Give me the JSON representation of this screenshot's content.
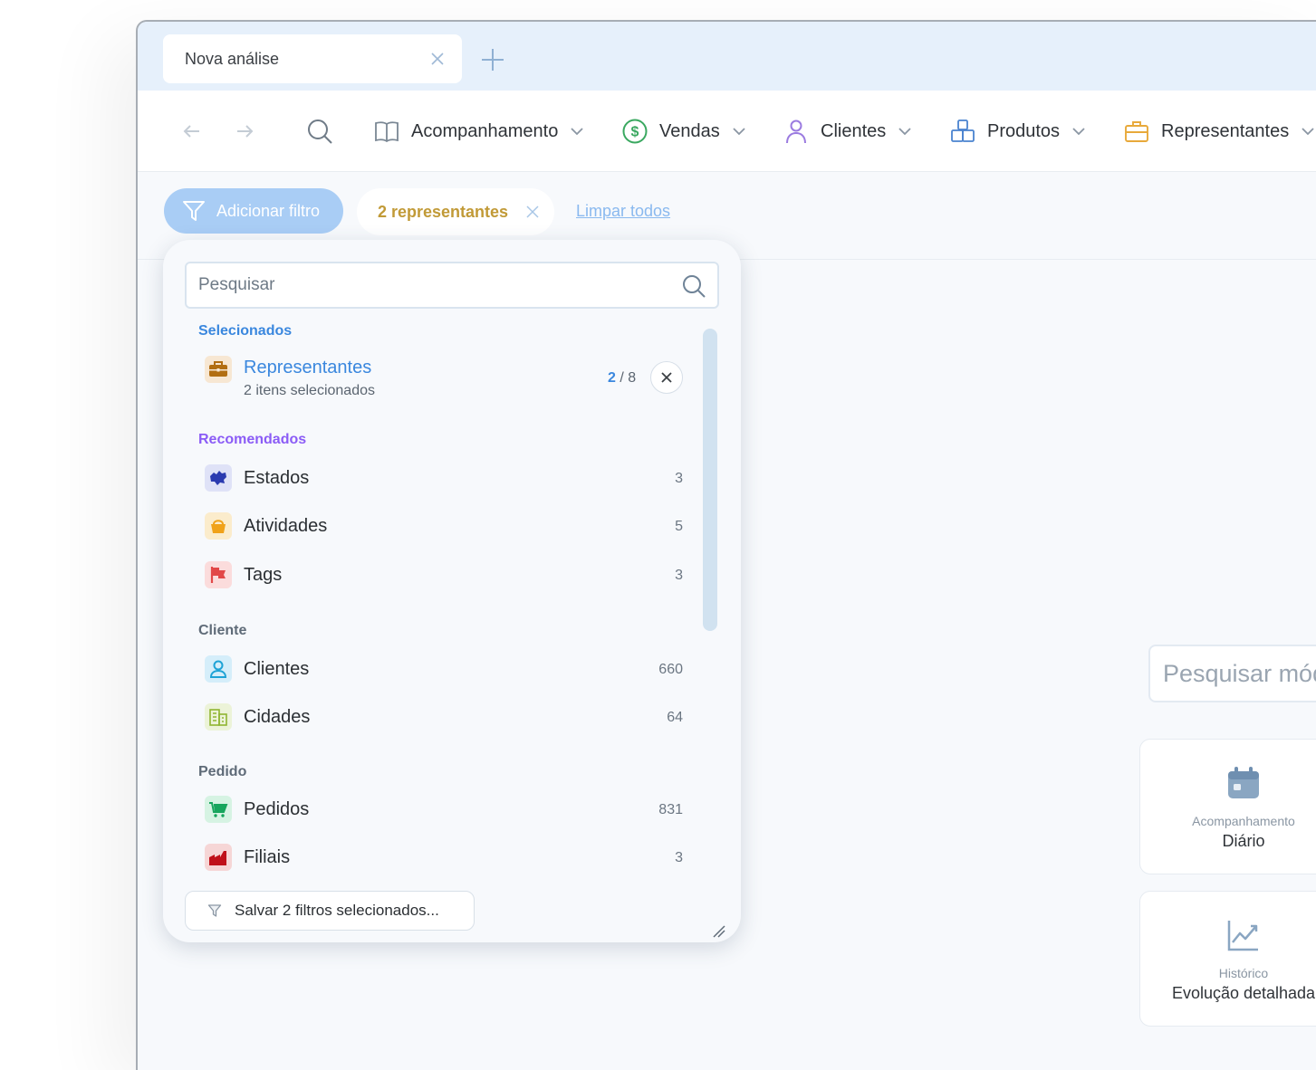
{
  "tab": {
    "title": "Nova análise"
  },
  "nav": {
    "items": [
      {
        "label": "Acompanhamento"
      },
      {
        "label": "Vendas"
      },
      {
        "label": "Clientes"
      },
      {
        "label": "Produtos"
      },
      {
        "label": "Representantes"
      }
    ]
  },
  "filterbar": {
    "add_label": "Adicionar filtro",
    "chip_label": "2 representantes",
    "clear_label": "Limpar todos"
  },
  "panel": {
    "search_placeholder": "Pesquisar",
    "selected_heading": "Selecionados",
    "selected_item": {
      "title": "Representantes",
      "subtitle": "2 itens selecionados",
      "count_selected": "2",
      "count_sep": "/",
      "count_total": "8"
    },
    "recommended_heading": "Recomendados",
    "recommended": [
      {
        "label": "Estados",
        "count": "3"
      },
      {
        "label": "Atividades",
        "count": "5"
      },
      {
        "label": "Tags",
        "count": "3"
      }
    ],
    "cliente_heading": "Cliente",
    "cliente": [
      {
        "label": "Clientes",
        "count": "660"
      },
      {
        "label": "Cidades",
        "count": "64"
      }
    ],
    "pedido_heading": "Pedido",
    "pedido": [
      {
        "label": "Pedidos",
        "count": "831"
      },
      {
        "label": "Filiais",
        "count": "3"
      }
    ],
    "save_label": "Salvar 2 filtros selecionados..."
  },
  "right": {
    "search_placeholder": "Pesquisar módulos",
    "cards": [
      {
        "sub": "Acompanhamento",
        "title": "Diário"
      },
      {
        "sub": "Histórico",
        "title": "Evolução detalhada"
      }
    ]
  },
  "colors": {
    "accent": "#3a87de",
    "recommended": "#8b5cf6",
    "chip_text": "#c19a37",
    "filter_button": "#a9cdf5"
  }
}
